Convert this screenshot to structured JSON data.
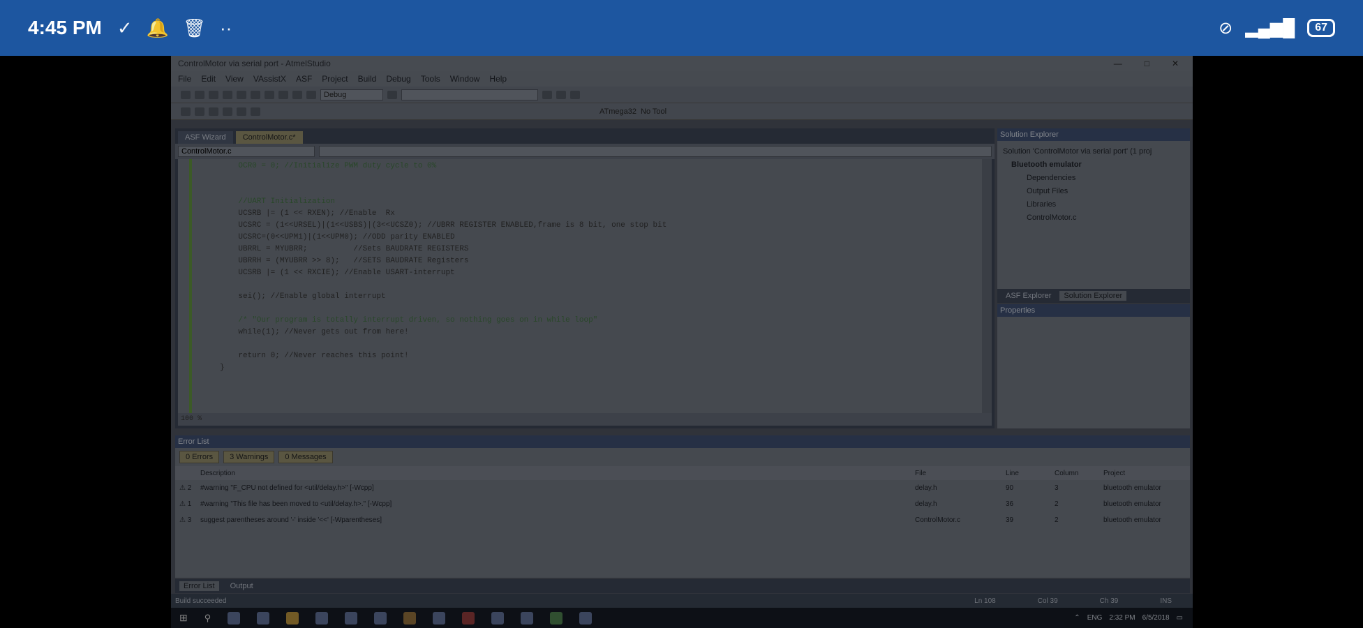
{
  "status_bar": {
    "time": "4:45 PM",
    "battery": "67"
  },
  "window": {
    "title": "ControlMotor via serial port - AtmelStudio",
    "menu": [
      "File",
      "Edit",
      "View",
      "VAssistX",
      "ASF",
      "Project",
      "Build",
      "Debug",
      "Tools",
      "Window",
      "Help"
    ],
    "config_combo": "Debug",
    "toolbar_right_labels": [
      "ATmega32",
      "No Tool"
    ]
  },
  "doc_tabs": [
    "ASF Wizard",
    "ControlMotor.c*"
  ],
  "nav_combo": "ControlMotor.c",
  "code_lines": [
    {
      "t": "    OCR0 = 0; //Initialize PWM duty cycle to 0%",
      "c": "c-com"
    },
    {
      "t": "",
      "c": ""
    },
    {
      "t": "",
      "c": ""
    },
    {
      "t": "    //UART Initialization",
      "c": "c-com"
    },
    {
      "t": "    UCSRB |= (1 << RXEN); //Enable  Rx",
      "c": ""
    },
    {
      "t": "    UCSRC = (1<<URSEL)|(1<<USBS)|(3<<UCSZ0); //UBRR REGISTER ENABLED,frame is 8 bit, one stop bit",
      "c": ""
    },
    {
      "t": "    UCSRC=(0<<UPM1)|(1<<UPM0); //ODD parity ENABLED",
      "c": ""
    },
    {
      "t": "    UBRRL = MYUBRR;          //Sets BAUDRATE REGISTERS",
      "c": ""
    },
    {
      "t": "    UBRRH = (MYUBRR >> 8);   //SETS BAUDRATE Registers",
      "c": ""
    },
    {
      "t": "    UCSRB |= (1 << RXCIE); //Enable USART-interrupt",
      "c": ""
    },
    {
      "t": "",
      "c": ""
    },
    {
      "t": "    sei(); //Enable global interrupt",
      "c": ""
    },
    {
      "t": "",
      "c": ""
    },
    {
      "t": "    /* \"Our program is totally interrupt driven, so nothing goes on in while loop\"",
      "c": "c-com"
    },
    {
      "t": "    while(1); //Never gets out from here!",
      "c": ""
    },
    {
      "t": "",
      "c": ""
    },
    {
      "t": "    return 0; //Never reaches this point!",
      "c": ""
    },
    {
      "t": "}",
      "c": ""
    }
  ],
  "zoom": "100 %",
  "solution_explorer": {
    "title": "Solution Explorer",
    "items": [
      "Solution 'ControlMotor via serial port' (1 proj",
      "Bluetooth emulator",
      "Dependencies",
      "Output Files",
      "Libraries",
      "ControlMotor.c"
    ]
  },
  "panel_tabs": [
    "ASF Explorer",
    "Solution Explorer"
  ],
  "properties_title": "Properties",
  "error_list": {
    "title": "Error List",
    "tabs": [
      "0 Errors",
      "3 Warnings",
      "0 Messages"
    ],
    "columns": [
      "",
      "Description",
      "File",
      "Line",
      "Column",
      "Project"
    ],
    "rows": [
      [
        "2",
        "#warning \"F_CPU not defined for <util/delay.h>\" [-Wcpp]",
        "delay.h",
        "90",
        "3",
        "bluetooth emulator"
      ],
      [
        "1",
        "#warning \"This file has been moved to <util/delay.h>.\" [-Wcpp]",
        "delay.h",
        "36",
        "2",
        "bluetooth emulator"
      ],
      [
        "3",
        "suggest parentheses around '-' inside '<<' [-Wparentheses]",
        "ControlMotor.c",
        "39",
        "2",
        "bluetooth emulator"
      ]
    ]
  },
  "bottom_tabs": [
    "Error List",
    "Output"
  ],
  "status": {
    "text": "Build succeeded",
    "ln": "Ln 108",
    "col": "Col 39",
    "ch": "Ch 39",
    "ins": "INS"
  },
  "tray": {
    "lang": "ENG",
    "time": "2:32 PM",
    "date": "6/5/2018"
  }
}
